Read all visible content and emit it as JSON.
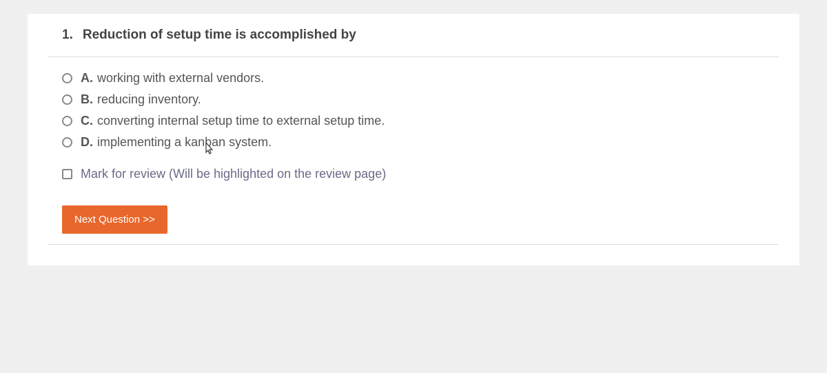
{
  "question": {
    "number": "1.",
    "text": "Reduction of setup time is accomplished by"
  },
  "options": [
    {
      "letter": "A.",
      "text": "working with external vendors."
    },
    {
      "letter": "B.",
      "text": "reducing inventory."
    },
    {
      "letter": "C.",
      "text": "converting internal setup time to external setup time."
    },
    {
      "letter": "D.",
      "text": "implementing a kanban system."
    }
  ],
  "review": {
    "label": "Mark for review (Will be highlighted on the review page)"
  },
  "buttons": {
    "next": "Next Question >>"
  }
}
